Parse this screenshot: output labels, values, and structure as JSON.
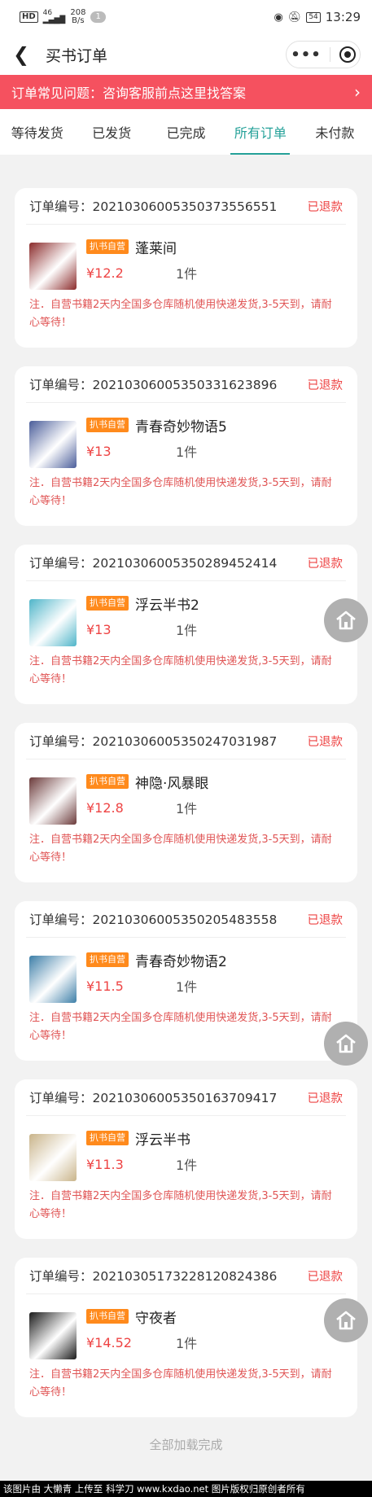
{
  "statusbar": {
    "hd": "HD",
    "net_gen": "46",
    "speed_top": "208",
    "speed_bottom": "B/s",
    "notif_count": "1",
    "battery": "54",
    "time": "13:29"
  },
  "nav": {
    "title": "买书订单"
  },
  "faq": {
    "text": "订单常见问题：咨询客服前点这里找答案"
  },
  "tabs": [
    {
      "label": "等待发货"
    },
    {
      "label": "已发货"
    },
    {
      "label": "已完成"
    },
    {
      "label": "所有订单",
      "active": true
    },
    {
      "label": "未付款"
    }
  ],
  "order_no_label": "订单编号：",
  "self_badge": "扒书自营",
  "orders": [
    {
      "no": "20210306005350373556551",
      "status": "已退款",
      "title": "蓬莱间",
      "price": "¥12.2",
      "qty": "1件",
      "note": "注．自营书籍2天内全国多仓库随机使用快递发货,3-5天到，请耐心等待！",
      "cover_color": "#8b2b2b"
    },
    {
      "no": "20210306005350331623896",
      "status": "已退款",
      "title": "青春奇妙物语5",
      "price": "¥13",
      "qty": "1件",
      "note": "注．自营书籍2天内全国多仓库随机使用快递发货,3-5天到，请耐心等待！",
      "cover_color": "#4a5d9a"
    },
    {
      "no": "20210306005350289452414",
      "status": "已退款",
      "title": "浮云半书2",
      "price": "¥13",
      "qty": "1件",
      "note": "注．自营书籍2天内全国多仓库随机使用快递发货,3-5天到，请耐心等待！",
      "cover_color": "#4fb5c9"
    },
    {
      "no": "20210306005350247031987",
      "status": "已退款",
      "title": "神隐·风暴眼",
      "price": "¥12.8",
      "qty": "1件",
      "note": "注．自营书籍2天内全国多仓库随机使用快递发货,3-5天到，请耐心等待！",
      "cover_color": "#6b3a3a"
    },
    {
      "no": "20210306005350205483558",
      "status": "已退款",
      "title": "青春奇妙物语2",
      "price": "¥11.5",
      "qty": "1件",
      "note": "注．自营书籍2天内全国多仓库随机使用快递发货,3-5天到，请耐心等待！",
      "cover_color": "#3d7fa8"
    },
    {
      "no": "20210306005350163709417",
      "status": "已退款",
      "title": "浮云半书",
      "price": "¥11.3",
      "qty": "1件",
      "note": "注．自营书籍2天内全国多仓库随机使用快递发货,3-5天到，请耐心等待！",
      "cover_color": "#c9b48a"
    },
    {
      "no": "20210305173228120824386",
      "status": "已退款",
      "title": "守夜者",
      "price": "¥14.52",
      "qty": "1件",
      "note": "注．自营书籍2天内全国多仓库随机使用快递发货,3-5天到，请耐心等待！",
      "cover_color": "#1a1a1a"
    }
  ],
  "end_text": "全部加载完成",
  "watermark": "该图片由 大懒青 上传至 科学刀 www.kxdao.net 图片版权归原创者所有",
  "colors": {
    "accent": "#25a199",
    "faq_bg": "#f5515f",
    "status_red": "#e44",
    "badge_orange": "#ff8a1c"
  }
}
